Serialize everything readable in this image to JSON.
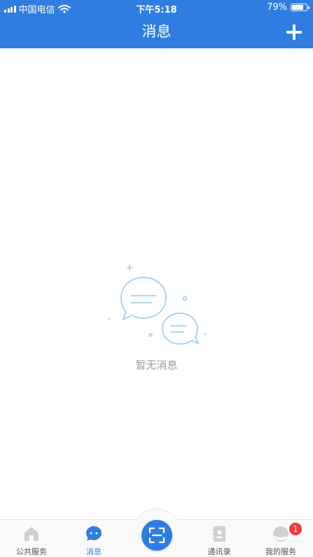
{
  "status_bar": {
    "carrier": "中国电信",
    "time": "下午5:18",
    "battery": "79%",
    "battery_level": 0.79
  },
  "header": {
    "title": "消息",
    "add_icon": "plus-icon"
  },
  "empty_state": {
    "text": "暂无消息",
    "icon": "chat-bubbles-icon"
  },
  "tabbar": {
    "tabs": [
      {
        "label": "公共服务",
        "icon": "house-icon"
      },
      {
        "label": "消息",
        "icon": "message-icon",
        "active": true
      },
      {
        "label": "通讯录",
        "icon": "contacts-icon"
      },
      {
        "label": "我的服务",
        "icon": "profile-icon",
        "badge": "1"
      }
    ],
    "scan_icon": "scan-icon"
  },
  "colors": {
    "primary": "#2f7de1",
    "badge": "#f03a3a",
    "muted_text": "#9a9a9a"
  }
}
